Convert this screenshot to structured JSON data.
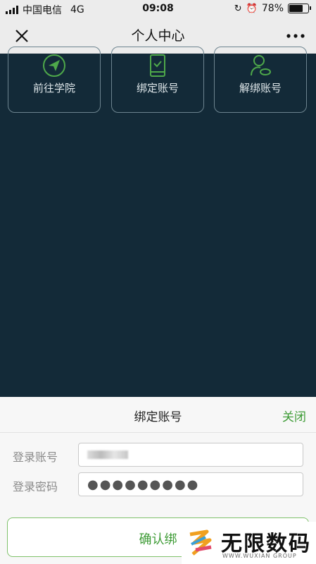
{
  "status_bar": {
    "carrier": "中国电信",
    "network": "4G",
    "time": "09:08",
    "battery": "78%",
    "battery_level": 0.78
  },
  "nav": {
    "title": "个人中心"
  },
  "cards": [
    {
      "label": "前往学院",
      "icon": "paper-plane-icon"
    },
    {
      "label": "绑定账号",
      "icon": "phone-check-icon"
    },
    {
      "label": "解绑账号",
      "icon": "user-unlink-icon"
    }
  ],
  "sheet": {
    "title": "绑定账号",
    "close": "关闭",
    "account_label": "登录账号",
    "password_label": "登录密码",
    "password_value": "●●●●●●●●●",
    "confirm_label": "确认绑"
  },
  "watermark": {
    "text": "无限数码",
    "sub": "WWW.WUXIAN GROUP"
  },
  "colors": {
    "accent_green": "#3d9b35",
    "content_bg": "#132a38"
  }
}
